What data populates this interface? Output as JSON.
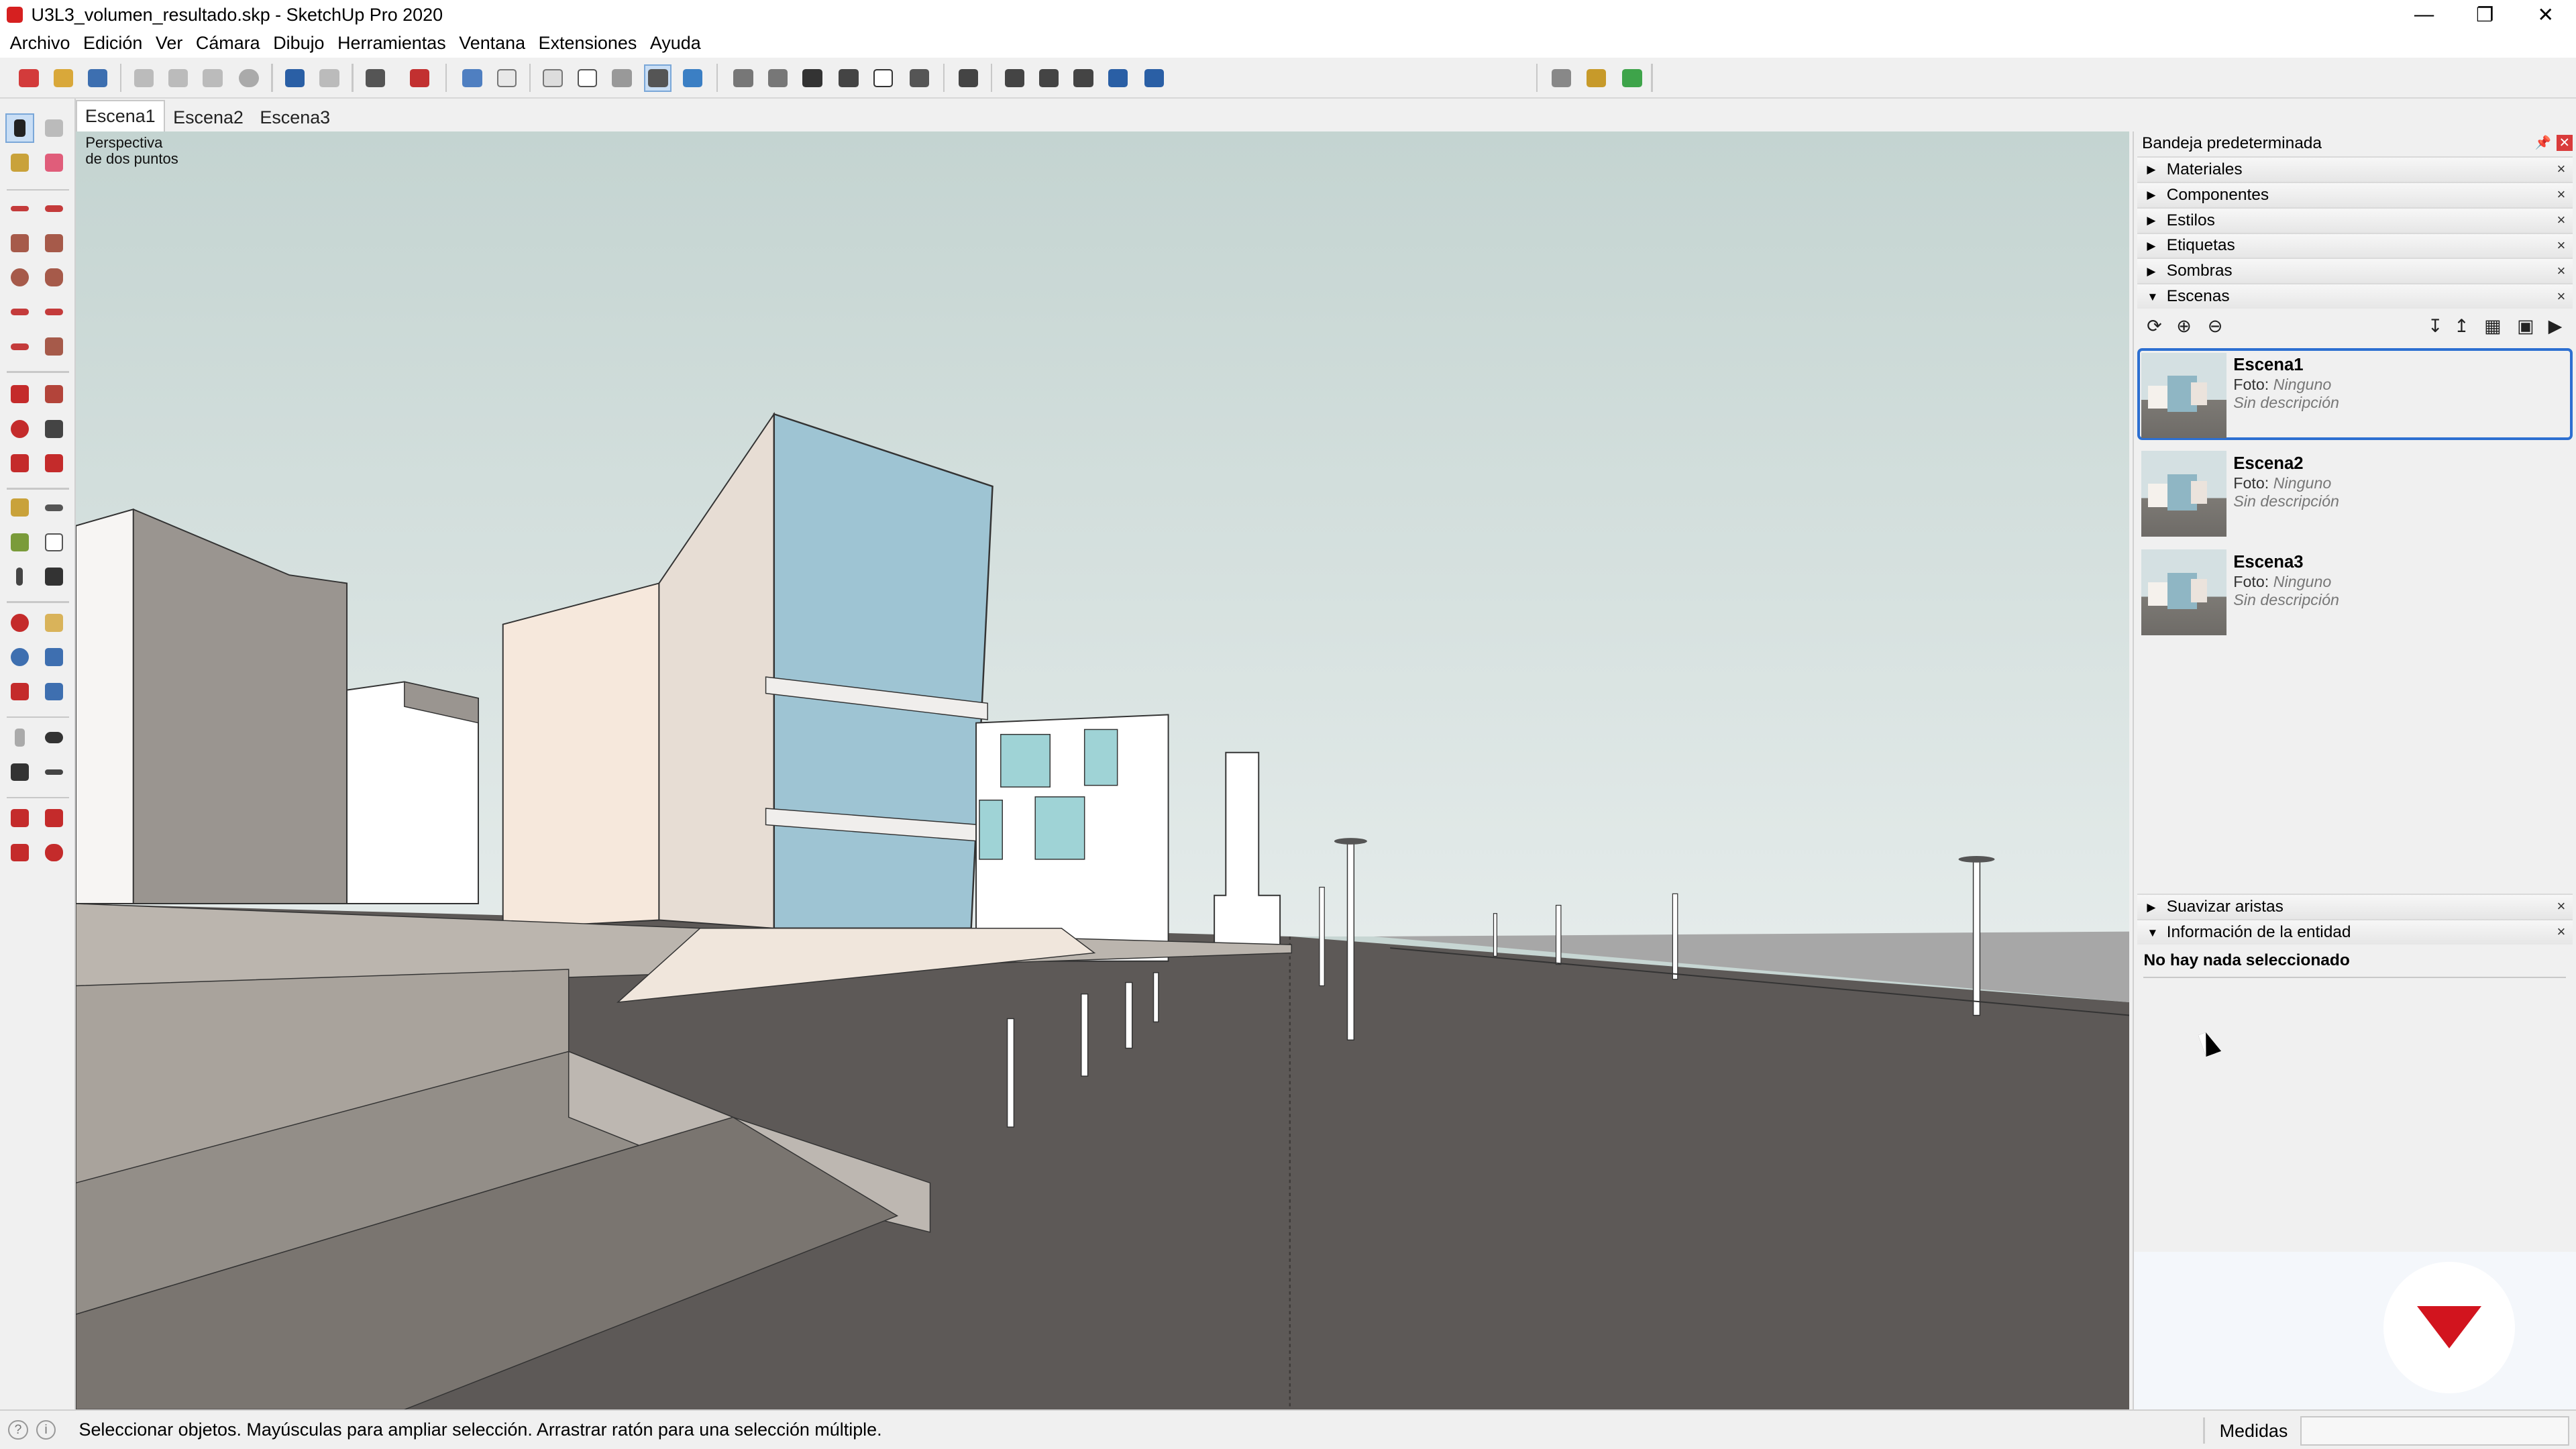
{
  "window": {
    "title": "U3L3_volumen_resultado.skp - SketchUp Pro 2020",
    "controls": [
      "minimize",
      "restore",
      "close"
    ]
  },
  "menu": [
    "Archivo",
    "Edición",
    "Ver",
    "Cámara",
    "Dibujo",
    "Herramientas",
    "Ventana",
    "Extensiones",
    "Ayuda"
  ],
  "tabs": [
    "Escena1",
    "Escena2",
    "Escena3"
  ],
  "viewport": {
    "camera_label_line1": "Perspectiva",
    "camera_label_line2": "de dos puntos"
  },
  "tray": {
    "title": "Bandeja predeterminada",
    "panels": [
      "Materiales",
      "Componentes",
      "Estilos",
      "Etiquetas",
      "Sombras"
    ],
    "scenes_panel": "Escenas",
    "scenes": [
      {
        "name": "Escena1",
        "foto_label": "Foto:",
        "foto_value": "Ninguno",
        "description": "Sin descripción"
      },
      {
        "name": "Escena2",
        "foto_label": "Foto:",
        "foto_value": "Ninguno",
        "description": "Sin descripción"
      },
      {
        "name": "Escena3",
        "foto_label": "Foto:",
        "foto_value": "Ninguno",
        "description": "Sin descripción"
      }
    ],
    "suavizar_panel": "Suavizar aristas",
    "entity_panel": "Información de la entidad",
    "entity_text": "No hay nada seleccionado"
  },
  "status": {
    "hint": "Seleccionar objetos. Mayúsculas para ampliar selección. Arrastrar ratón para una selección múltiple.",
    "measure_label": "Medidas",
    "measure_value": ""
  },
  "colors": {
    "sky": "#c7d6d3",
    "ground": "#5d5957",
    "glass": "#9ec4d3",
    "brand_red": "#d2141e",
    "selection_blue": "#2c6fd1"
  }
}
